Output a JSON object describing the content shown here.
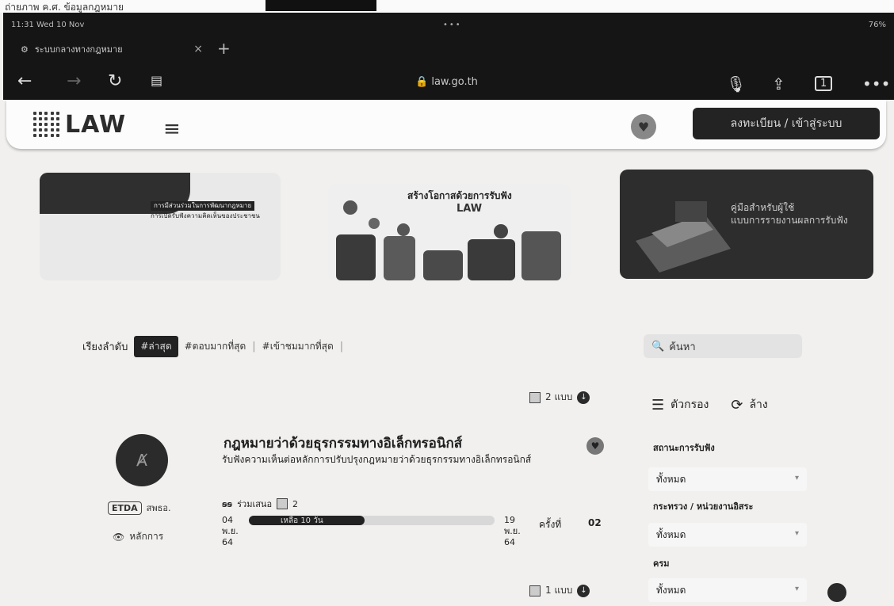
{
  "scan_caption": "ถ่ายภาพ ค.ศ. ข้อมูลกฎหมาย",
  "browser": {
    "time": "11:31 Wed 10 Nov",
    "battery": "76%",
    "tab_title": "ระบบกลางทางกฎหมาย",
    "url": "law.go.th",
    "tab_count": "1"
  },
  "header": {
    "logo_text": "LAW",
    "login_label": "ลงทะเบียน / เข้าสู่ระบบ"
  },
  "banners": {
    "b1_label": "การมีส่วนร่วมในการพัฒนากฎหมาย",
    "b1_text": "การเปิดรับฟังความคิดเห็นของประชาชน",
    "b2_title": "สร้างโอกาสด้วยการรับฟัง",
    "b2_logo": "LAW",
    "b3_line1": "คู่มือสำหรับผู้ใช้",
    "b3_line2": "แบบการรายงานผลการรับฟัง"
  },
  "sort": {
    "label": "เรียงลำดับ",
    "options": [
      "#ล่าสุด",
      "#ตอบมากที่สุด",
      "#เข้าชมมากที่สุด"
    ]
  },
  "search": {
    "placeholder": "ค้นหา"
  },
  "list_top": {
    "count_label": "2 แบบ"
  },
  "filters": {
    "title": "ตัวกรอง",
    "clear": "ล้าง",
    "status_label": "สถานะการรับฟัง",
    "status_value": "ทั้งหมด",
    "agency_label": "กระทรวง / หน่วยงานอิสระ",
    "agency_value": "ทั้งหมด",
    "type_label": "ครม",
    "type_value": "ทั้งหมด"
  },
  "card": {
    "title": "กฎหมายว่าด้วยธุรกรรมทางอิเล็กทรอนิกส์",
    "description": "รับฟังความเห็นต่อหลักการปรับปรุงกฎหมายว่าด้วยธุรกรรมทางอิเล็กทรอนิกส์",
    "org_tag": "ETDA",
    "org_name": "สพธอ.",
    "principle": "หลักการ",
    "participants_label": "ร่วมเสนอ",
    "comments": "2",
    "start_date": "04 พ.ย. 64",
    "end_date": "19 พ.ย. 64",
    "remaining_label": "เหลือ 10 วัน",
    "progress": 0.47,
    "round_label": "ครั้งที่",
    "round_value": "02"
  },
  "list_bottom": {
    "count_label": "1 แบบ"
  }
}
